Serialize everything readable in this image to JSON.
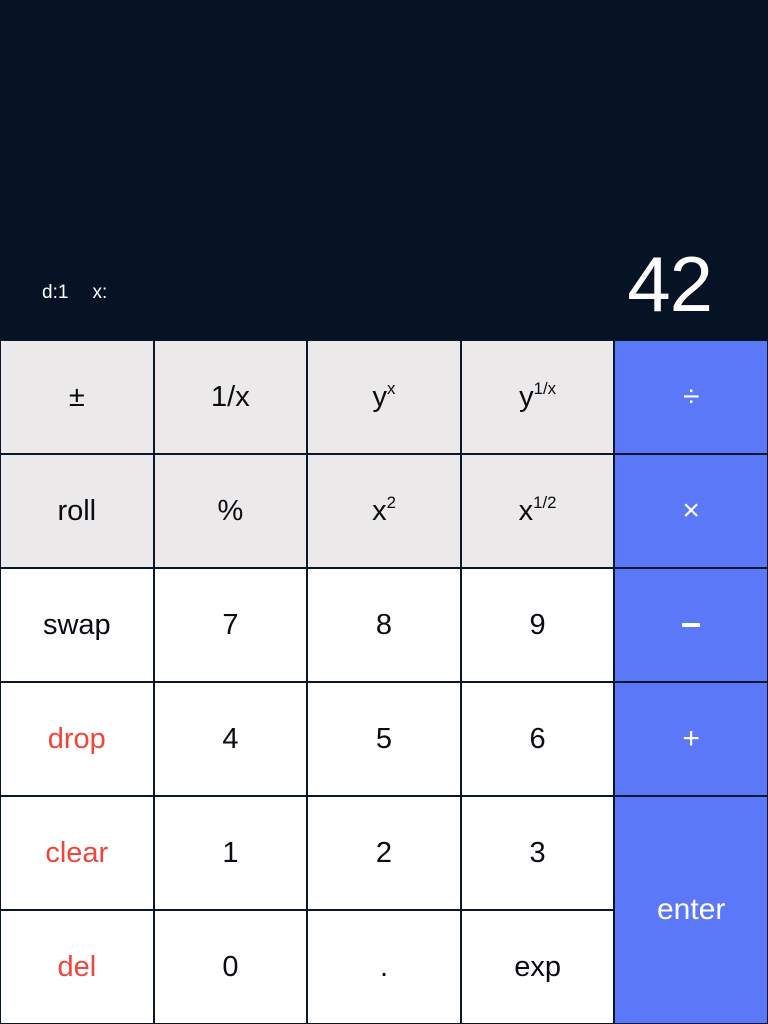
{
  "display": {
    "d_label": "d:",
    "d_value": "1",
    "x_label": "x:",
    "x_value": "",
    "result": "42"
  },
  "keys": {
    "plusminus": "±",
    "reciprocal": "1/x",
    "ypowx_base": "y",
    "ypowx_exp": "x",
    "yrootx_base": "y",
    "yrootx_exp": "1/x",
    "divide": "÷",
    "roll": "roll",
    "percent": "%",
    "xsq_base": "x",
    "xsq_exp": "2",
    "xroot_base": "x",
    "xroot_exp": "1/2",
    "multiply": "×",
    "swap": "swap",
    "n7": "7",
    "n8": "8",
    "n9": "9",
    "minus": "–",
    "drop": "drop",
    "n4": "4",
    "n5": "5",
    "n6": "6",
    "plus": "+",
    "clear": "clear",
    "n1": "1",
    "n2": "2",
    "n3": "3",
    "enter": "enter",
    "del": "del",
    "n0": "0",
    "dot": ".",
    "exp": "exp"
  }
}
